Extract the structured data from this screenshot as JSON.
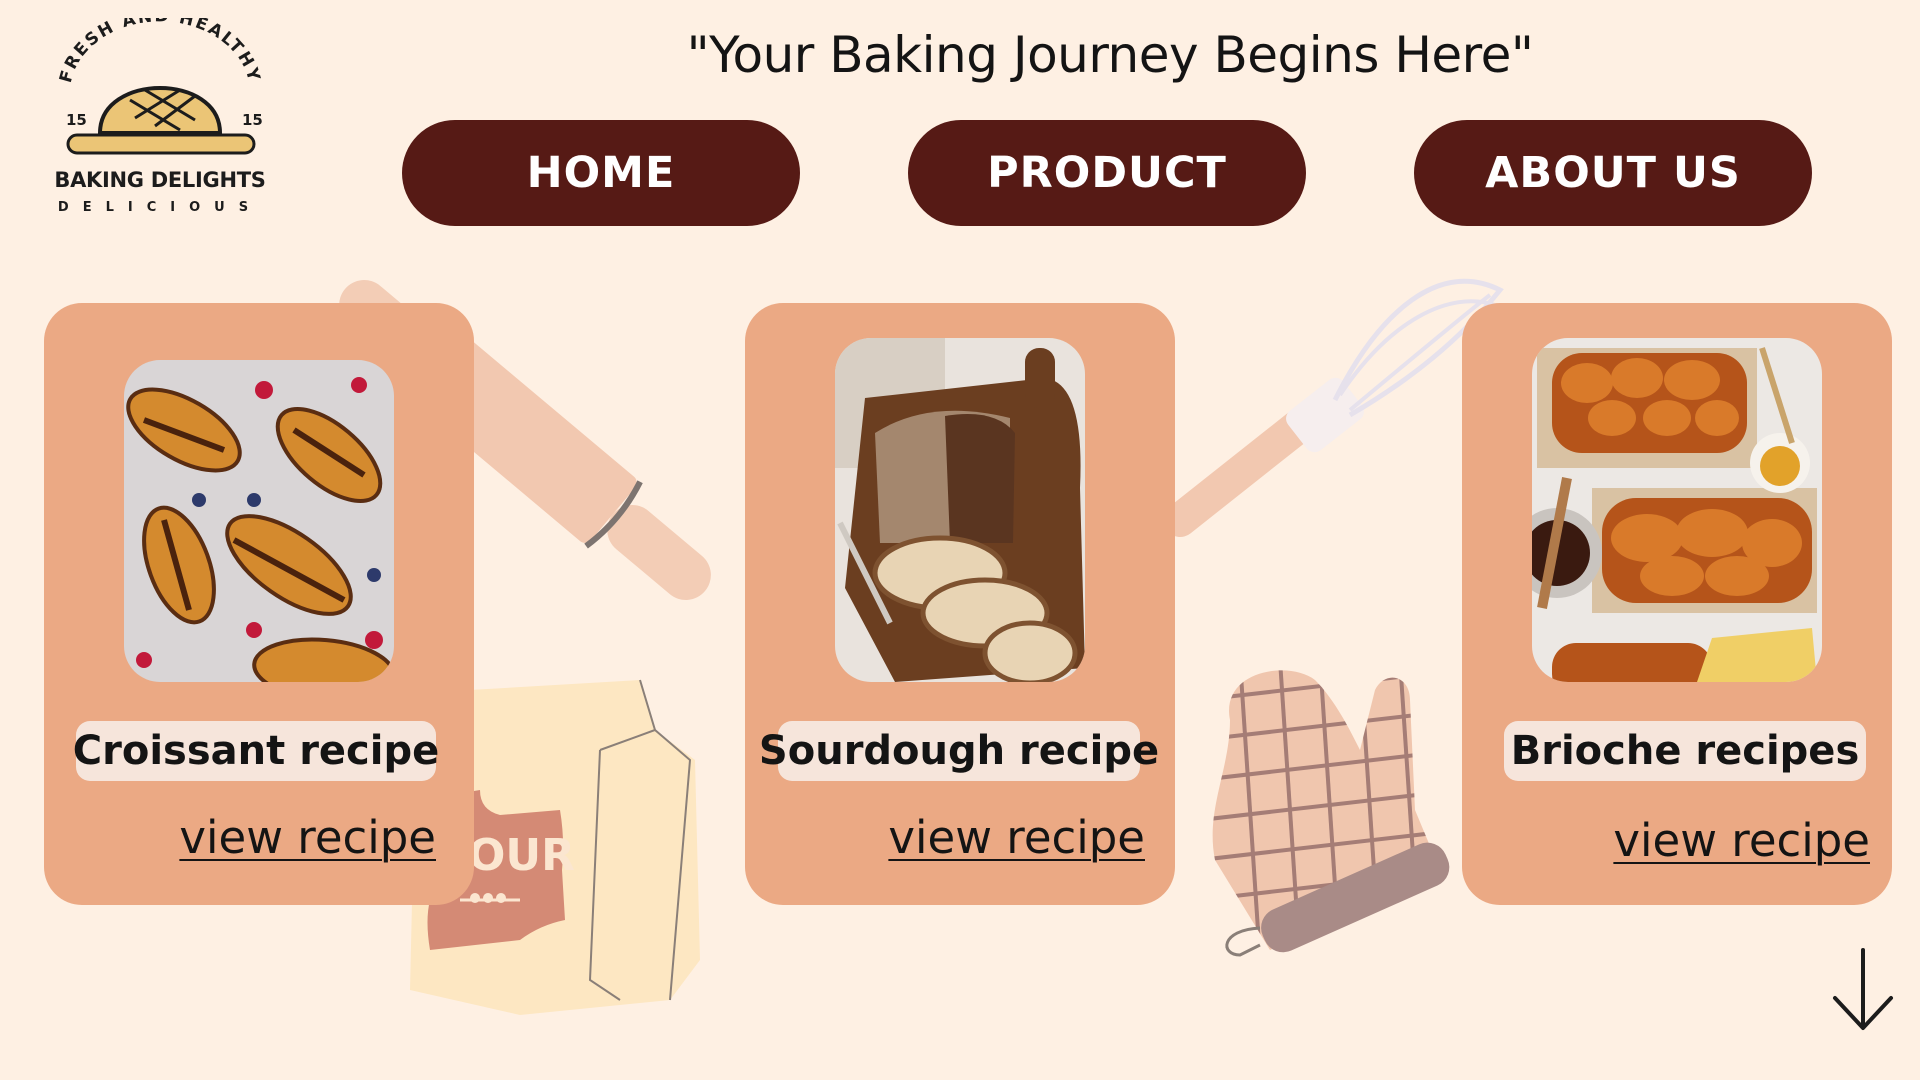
{
  "logo": {
    "arc_text": "FRESH AND HEALTHY",
    "num_left": "15",
    "num_right": "15",
    "name": "BAKING DELIGHTS",
    "tagline": "DELICIOUS"
  },
  "header": {
    "tagline": "\"Your Baking Journey Begins Here\""
  },
  "nav": {
    "items": [
      {
        "label": "HOME"
      },
      {
        "label": "PRODUCT"
      },
      {
        "label": "ABOUT US"
      }
    ]
  },
  "cards": [
    {
      "title": "Croissant recipe",
      "link": "view recipe",
      "photo_icon": "croissant-photo"
    },
    {
      "title": "Sourdough recipe",
      "link": "view recipe",
      "photo_icon": "sourdough-photo"
    },
    {
      "title": "Brioche recipes",
      "link": "view recipe",
      "photo_icon": "brioche-photo"
    }
  ],
  "decor": {
    "flour_bag_text": "OUR"
  },
  "scroll": {
    "icon": "arrow-down-icon"
  },
  "colors": {
    "background": "#FEF0E3",
    "nav_button": "#561A15",
    "card": "#EBA984",
    "card_label": "#F6E5DB"
  }
}
